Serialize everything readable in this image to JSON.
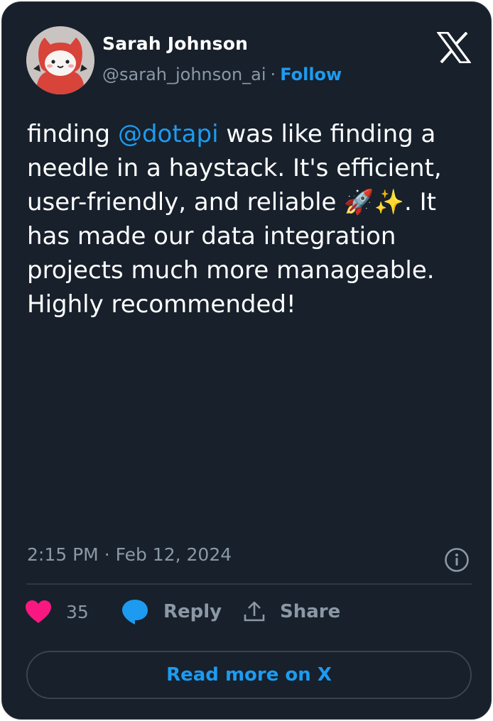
{
  "author": {
    "name": "Sarah Johnson",
    "handle": "@sarah_johnson_ai",
    "separator": "·",
    "follow_label": "Follow"
  },
  "tweet": {
    "text_before": "finding ",
    "mention": "@dotapi",
    "text_middle": " was like finding a needle in a haystack. It's efficient, user-friendly, and reliable ",
    "emoji": "🚀✨",
    "text_after": ". It has made our data integration projects much more manageable. Highly recommended!"
  },
  "meta": {
    "time": "2:15 PM",
    "separator": "·",
    "date": "Feb 12, 2024"
  },
  "actions": {
    "like_count": "35",
    "reply_label": "Reply",
    "share_label": "Share"
  },
  "read_more_label": "Read more on X",
  "icons": {
    "logo": "x-logo-icon",
    "info": "info-icon",
    "like": "heart-icon",
    "reply": "speech-bubble-icon",
    "share": "share-upload-icon"
  },
  "colors": {
    "background": "#17202b",
    "accent": "#1d9bf0",
    "muted": "#8b98a5",
    "like": "#f91880"
  }
}
